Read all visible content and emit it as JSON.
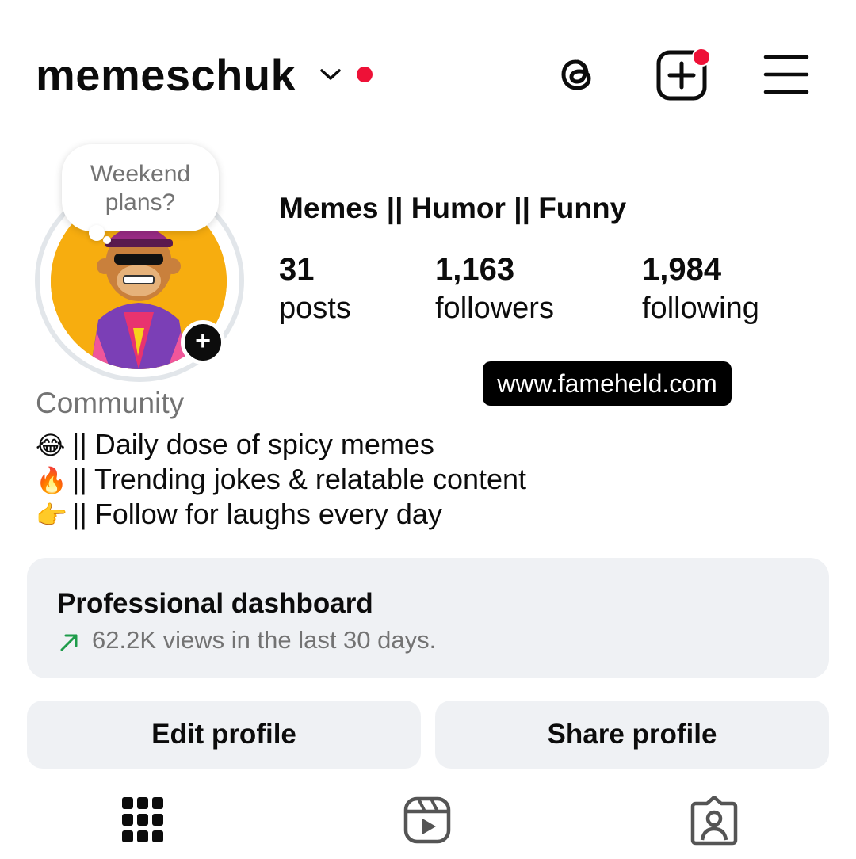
{
  "header": {
    "username": "memeschuk",
    "icons": [
      "chevron-down-icon",
      "threads-icon",
      "create-post-icon",
      "menu-icon"
    ],
    "notification_color": "#ee1137"
  },
  "note": {
    "text_line1": "Weekend",
    "text_line2": "plans?"
  },
  "profile": {
    "display_name": "Memes || Humor || Funny",
    "stats": [
      {
        "value": "31",
        "label": "posts"
      },
      {
        "value": "1,163",
        "label": "followers"
      },
      {
        "value": "1,984",
        "label": "following"
      }
    ],
    "category": "Community",
    "bio": [
      {
        "emoji": "😂",
        "text": "|| Daily dose of spicy memes"
      },
      {
        "emoji": "🔥",
        "text": "|| Trending jokes & relatable content"
      },
      {
        "emoji": "👉",
        "text": "|| Follow for laughs every day"
      }
    ],
    "add_story_symbol": "+"
  },
  "watermark": "www.fameheld.com",
  "dashboard": {
    "title": "Professional dashboard",
    "subtitle": "62.2K views in the last 30 days.",
    "trend_color": "#1e9c4a"
  },
  "buttons": {
    "edit": "Edit profile",
    "share": "Share profile"
  },
  "tabs": [
    "grid-icon",
    "reels-icon",
    "tagged-icon"
  ]
}
